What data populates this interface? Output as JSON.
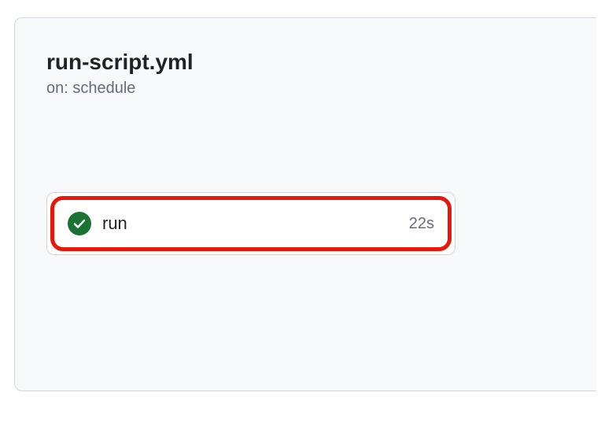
{
  "workflow": {
    "title": "run-script.yml",
    "trigger": "on: schedule"
  },
  "job": {
    "name": "run",
    "duration": "22s",
    "status": "success"
  }
}
